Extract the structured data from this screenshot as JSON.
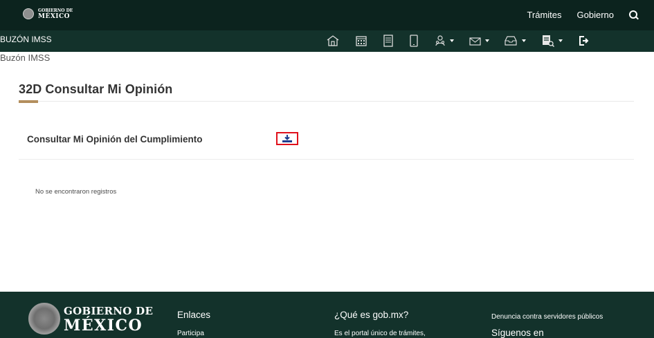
{
  "header": {
    "logo_line1": "GOBIERNO DE",
    "logo_line2": "MÉXICO",
    "nav": [
      "Trámites",
      "Gobierno"
    ]
  },
  "subnav": {
    "brand": "BUZÓN IMSS",
    "icons": [
      "home-icon",
      "calendar-icon",
      "document-icon",
      "mobile-icon",
      "users-icon",
      "mail-icon",
      "inbox-icon",
      "report-icon",
      "logout-icon"
    ]
  },
  "breadcrumb": "Buzón IMSS",
  "page": {
    "title": "32D Consultar Mi Opinión",
    "row_label": "Consultar Mi Opinión del Cumplimiento",
    "empty_message": "No se encontraron registros"
  },
  "footer": {
    "logo_line1": "GOBIERNO DE",
    "logo_line2": "MÉXICO",
    "links_heading": "Enlaces",
    "links_first": "Participa",
    "about_heading": "¿Qué es gob.mx?",
    "about_text": "Es el portal único de trámites,",
    "report_link": "Denuncia contra servidores públicos",
    "follow_heading": "Síguenos en"
  },
  "colors": {
    "topbar": "#0c231e",
    "subbar": "#13322b",
    "accent": "#b38e5d",
    "download_border": "#e0101b",
    "download_icon": "#1f3c8f"
  }
}
